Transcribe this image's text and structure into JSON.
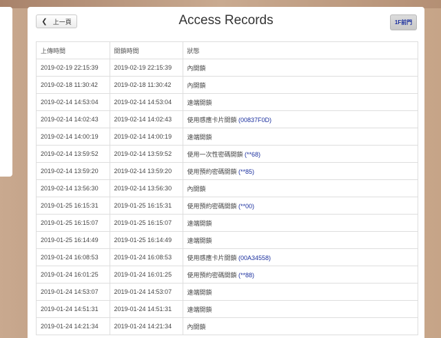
{
  "header": {
    "back_label": "上一頁",
    "title": "Access Records",
    "door_label": "1F前門"
  },
  "table": {
    "columns": [
      "上傳時間",
      "開鎖時間",
      "狀態"
    ],
    "rows": [
      {
        "upload": "2019-02-19 22:15:39",
        "unlock": "2019-02-19 22:15:39",
        "status": "內開鎖",
        "code": ""
      },
      {
        "upload": "2019-02-18 11:30:42",
        "unlock": "2019-02-18 11:30:42",
        "status": "內開鎖",
        "code": ""
      },
      {
        "upload": "2019-02-14 14:53:04",
        "unlock": "2019-02-14 14:53:04",
        "status": "遠端開鎖",
        "code": ""
      },
      {
        "upload": "2019-02-14 14:02:43",
        "unlock": "2019-02-14 14:02:43",
        "status": "使用感應卡片開鎖 ",
        "code": "(00837F0D)"
      },
      {
        "upload": "2019-02-14 14:00:19",
        "unlock": "2019-02-14 14:00:19",
        "status": "遠端開鎖",
        "code": ""
      },
      {
        "upload": "2019-02-14 13:59:52",
        "unlock": "2019-02-14 13:59:52",
        "status": "使用一次性密碼開鎖 ",
        "code": "(**68)"
      },
      {
        "upload": "2019-02-14 13:59:20",
        "unlock": "2019-02-14 13:59:20",
        "status": "使用預約密碼開鎖 ",
        "code": "(**85)"
      },
      {
        "upload": "2019-02-14 13:56:30",
        "unlock": "2019-02-14 13:56:30",
        "status": "內開鎖",
        "code": ""
      },
      {
        "upload": "2019-01-25 16:15:31",
        "unlock": "2019-01-25 16:15:31",
        "status": "使用預約密碼開鎖 ",
        "code": "(**00)"
      },
      {
        "upload": "2019-01-25 16:15:07",
        "unlock": "2019-01-25 16:15:07",
        "status": "遠端開鎖",
        "code": ""
      },
      {
        "upload": "2019-01-25 16:14:49",
        "unlock": "2019-01-25 16:14:49",
        "status": "遠端開鎖",
        "code": ""
      },
      {
        "upload": "2019-01-24 16:08:53",
        "unlock": "2019-01-24 16:08:53",
        "status": "使用感應卡片開鎖 ",
        "code": "(00A34558)"
      },
      {
        "upload": "2019-01-24 16:01:25",
        "unlock": "2019-01-24 16:01:25",
        "status": "使用預約密碼開鎖 ",
        "code": "(**88)"
      },
      {
        "upload": "2019-01-24 14:53:07",
        "unlock": "2019-01-24 14:53:07",
        "status": "遠端開鎖",
        "code": ""
      },
      {
        "upload": "2019-01-24 14:51:31",
        "unlock": "2019-01-24 14:51:31",
        "status": "遠端開鎖",
        "code": ""
      },
      {
        "upload": "2019-01-24 14:21:34",
        "unlock": "2019-01-24 14:21:34",
        "status": "內開鎖",
        "code": ""
      }
    ]
  },
  "colors": {
    "code_text": "#1a2f9e",
    "door_button_text": "#1a2f9e"
  }
}
